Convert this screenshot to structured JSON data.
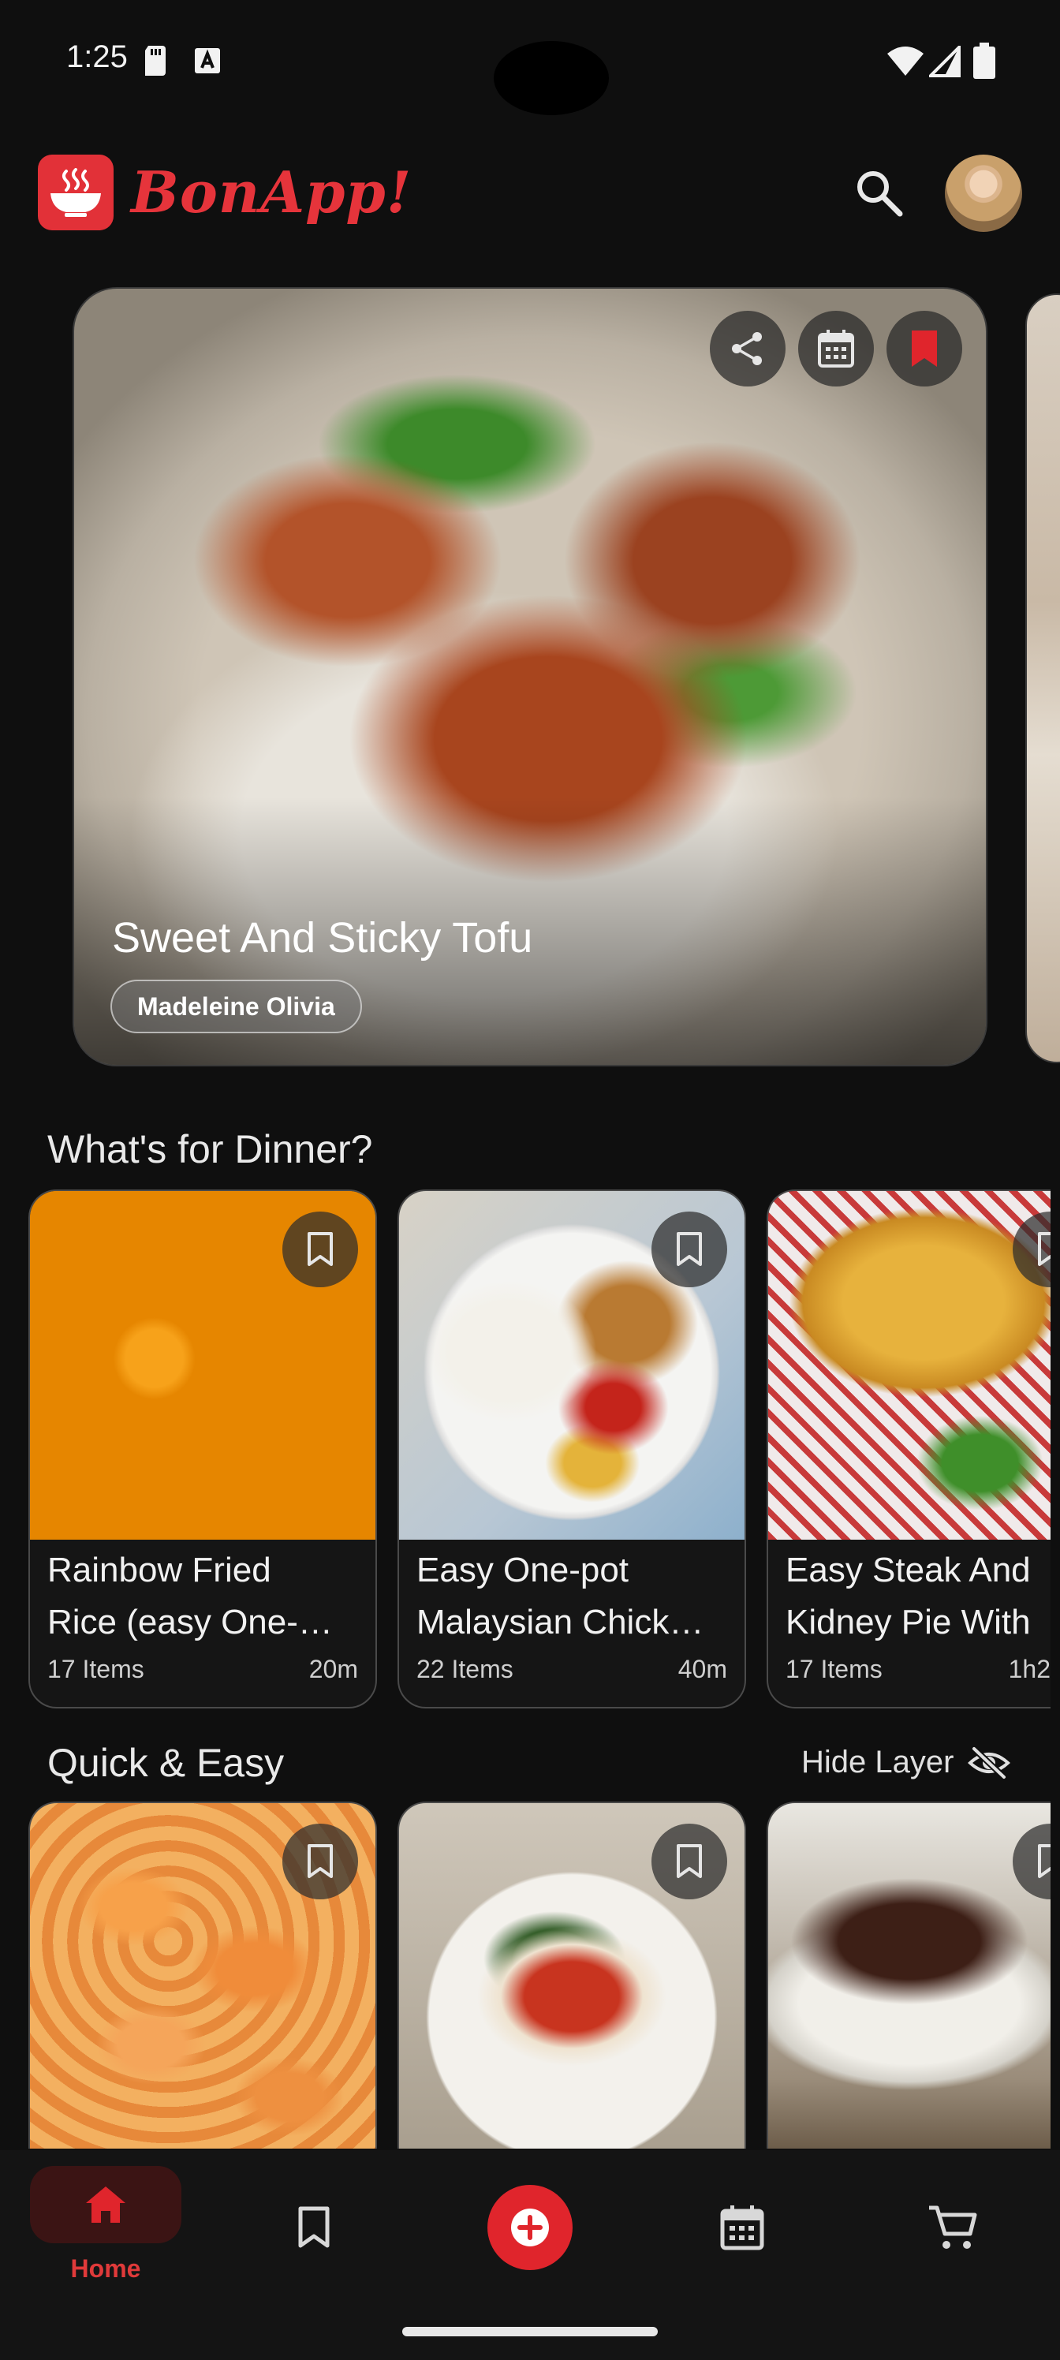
{
  "status_bar": {
    "time": "1:25"
  },
  "app": {
    "title": "BonApp!"
  },
  "hero": {
    "title": "Sweet And Sticky Tofu",
    "author": "Madeleine Olivia"
  },
  "sections": {
    "dinner": {
      "title": "What's for Dinner?",
      "cards": [
        {
          "name_line1": "Rainbow Fried",
          "name_line2": "Rice (easy One-…",
          "items": "17 Items",
          "time": "20m"
        },
        {
          "name_line1": "Easy One-pot",
          "name_line2": "Malaysian Chick…",
          "items": "22 Items",
          "time": "40m"
        },
        {
          "name_line1": "Easy Steak And",
          "name_line2": "Kidney Pie With",
          "items": "17 Items",
          "time": "1h2"
        }
      ]
    },
    "quick": {
      "title": "Quick & Easy",
      "hide_label": "Hide Layer"
    }
  },
  "nav": {
    "home_label": "Home"
  },
  "colors": {
    "accent": "#e0252c",
    "background": "#0f0f0f"
  }
}
